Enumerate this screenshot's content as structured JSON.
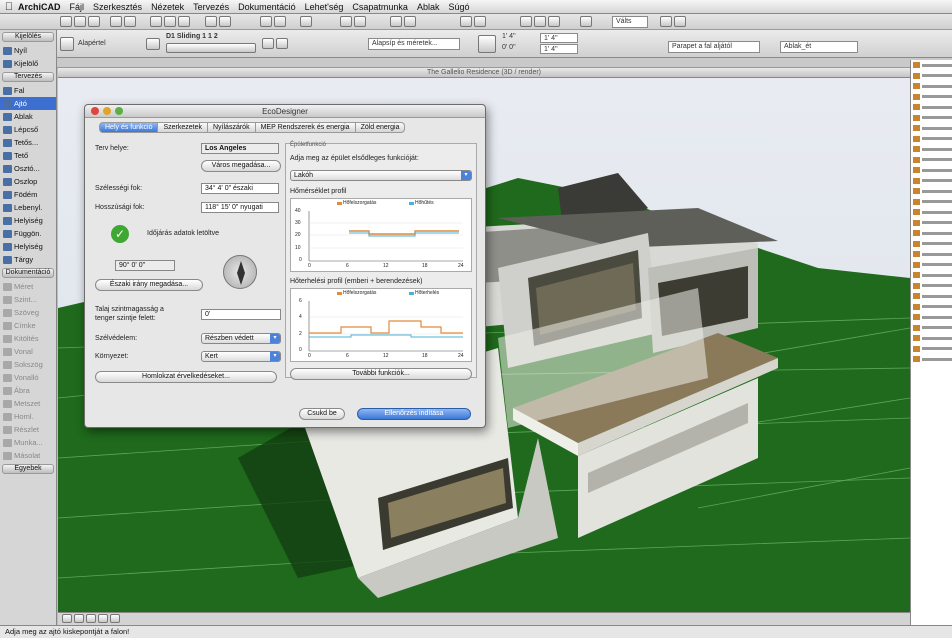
{
  "menubar": {
    "app_name": "ArchiCAD",
    "items": [
      "Fájl",
      "Szerkesztés",
      "Nézetek",
      "Tervezés",
      "Dokumentáció",
      "Lehet'ség",
      "Csapatmunka",
      "Ablak",
      "Súgó"
    ],
    "right_text": "Válts"
  },
  "infobox": {
    "layer_label": "Alapértel",
    "door_name": "D1 Sliding 1 1 2",
    "anchor_label": "Alapsíp és méretek...",
    "value1": "1' 4\"",
    "value2": "0' 0\"",
    "value3": "1' 4\"",
    "value4": "1' 4\"",
    "parapet_label": "Parapet a fal aljától",
    "zone_label": "Ablak_ét"
  },
  "window_title": "The Gallelio Residence (3D / render)",
  "toolbox": {
    "sections": [
      {
        "label": "Kijelölés",
        "items": [
          {
            "label": "Nyíl",
            "dim": false
          },
          {
            "label": "Kijelölő",
            "dim": false
          }
        ]
      },
      {
        "label": "Tervezés",
        "items": [
          {
            "label": "Fal",
            "dim": false
          },
          {
            "label": "Ajtó",
            "dim": false,
            "selected": true
          },
          {
            "label": "Ablak",
            "dim": false
          },
          {
            "label": "Lépcső",
            "dim": false
          },
          {
            "label": "Tetős...",
            "dim": false
          },
          {
            "label": "Tető",
            "dim": false
          },
          {
            "label": "Osztó...",
            "dim": false
          },
          {
            "label": "Oszlop",
            "dim": false
          },
          {
            "label": "Födém",
            "dim": false
          },
          {
            "label": "Lebenyl.",
            "dim": false
          },
          {
            "label": "Helyiség",
            "dim": false
          },
          {
            "label": "Függön.",
            "dim": false
          },
          {
            "label": "Helyiség",
            "dim": false
          },
          {
            "label": "Tárgy",
            "dim": false
          }
        ]
      },
      {
        "label": "Dokumentáció",
        "items": [
          {
            "label": "Méret",
            "dim": true
          },
          {
            "label": "Szint...",
            "dim": true
          },
          {
            "label": "Szöveg",
            "dim": true
          },
          {
            "label": "Címke",
            "dim": true
          },
          {
            "label": "Kitöltés",
            "dim": true
          },
          {
            "label": "Vonal",
            "dim": true
          },
          {
            "label": "Sokszög",
            "dim": true
          },
          {
            "label": "Vonalló",
            "dim": true
          },
          {
            "label": "Ábra",
            "dim": true
          },
          {
            "label": "Metszet",
            "dim": true
          },
          {
            "label": "Homl.",
            "dim": true
          },
          {
            "label": "Részlet",
            "dim": true
          },
          {
            "label": "Munka...",
            "dim": true
          },
          {
            "label": "Másolat",
            "dim": true
          }
        ]
      },
      {
        "label": "Egyebek",
        "items": []
      }
    ]
  },
  "dialog": {
    "title": "EcoDesigner",
    "tabs": [
      "Hely és funkció",
      "Szerkezetek",
      "Nyílászárók",
      "MEP Rendszerek és energia",
      "Zöld energia"
    ],
    "project_location_label": "Terv helye:",
    "project_location_value": "Los Angeles",
    "select_city_button": "Város megadása...",
    "latitude_label": "Szélességi fok:",
    "latitude_value": "34° 4' 0\" északi",
    "longitude_label": "Hosszúsági fok:",
    "longitude_value": "118° 15' 0\" nyugati",
    "weather_data_label": "Időjárás adatok letöltve",
    "north_value": "90° 0' 0\"",
    "north_button": "Északi irány megadása...",
    "altitude_label": "Talaj szintmagasság a tenger szintje felett:",
    "altitude_value": "0'",
    "shading_label": "Szélvédelem:",
    "shading_value": "Részben védett",
    "terrain_label": "Környezet:",
    "terrain_value": "Kert",
    "climate_button": "Homlokzat érvelkedéseket...",
    "function_section": "Épületfunkció",
    "function_prompt": "Adja meg az épület elsődleges funkcióját:",
    "function_value": "Lakóh",
    "temp_profile_label": "Hőmérséklet profil",
    "temp_legend_heat": "Hőfelszorgatás",
    "temp_legend_cool": "Hőhűtés",
    "internal_gain_label": "Hőterhelési profil (emberi + berendezések)",
    "internal_legend_a": "Hőfelszorgatás",
    "internal_legend_b": "Hőterhelés",
    "more_button": "További funkciók...",
    "close_button": "Csukd be",
    "run_button": "Ellenőrzés indítása",
    "temp_chart": {
      "yticks": [
        "40",
        "30",
        "20",
        "10",
        "0"
      ],
      "xticks": [
        "0",
        "6",
        "12",
        "18",
        "24"
      ]
    },
    "gain_chart": {
      "yticks": [
        "6",
        "4",
        "2",
        "0"
      ],
      "xticks": [
        "0",
        "6",
        "12",
        "18",
        "24"
      ]
    }
  },
  "status": {
    "hint": "Adja meg az ajtó kiskepontját a falon!"
  },
  "colors": {
    "terrain": "#1f6a1c",
    "accent": "#3a78d8",
    "heating": "#e08a3c",
    "cooling": "#4ab0d8"
  }
}
